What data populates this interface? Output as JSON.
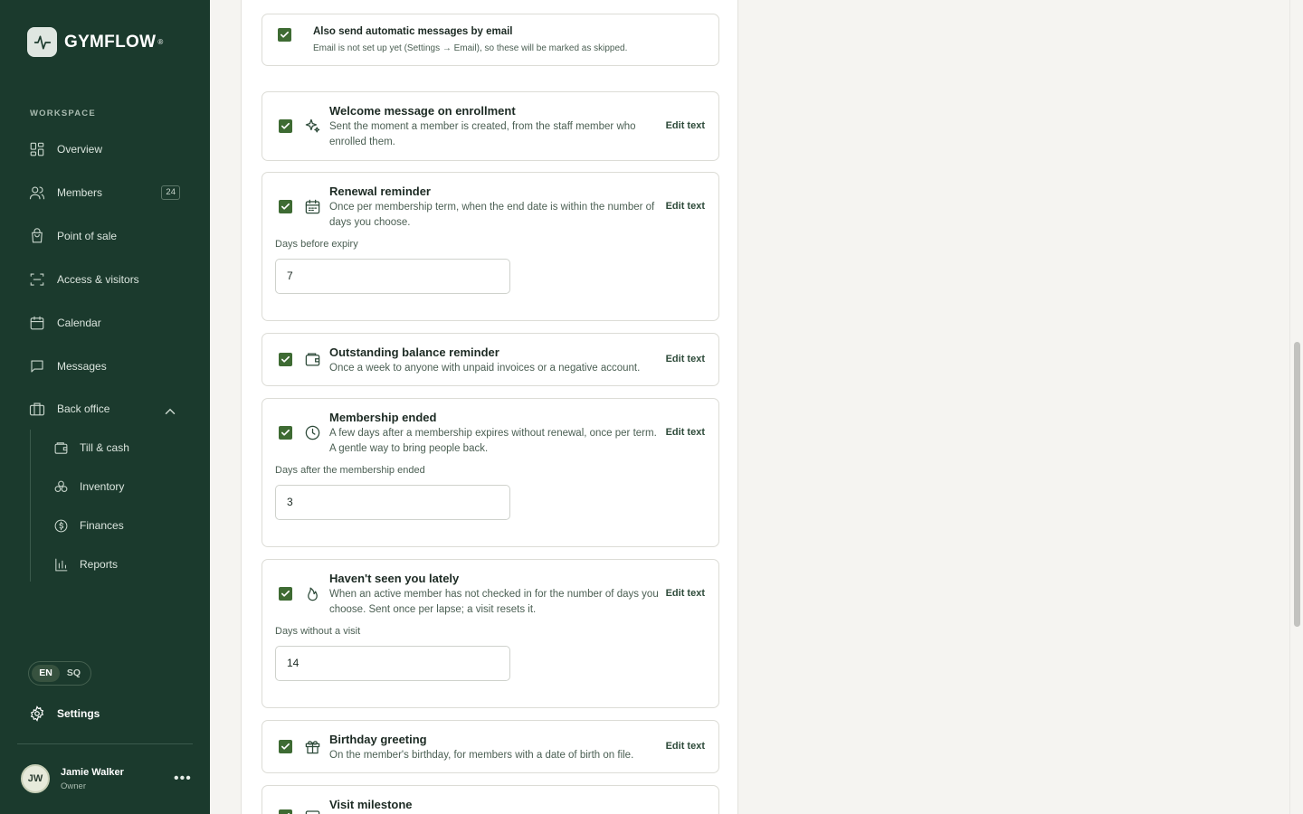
{
  "app": {
    "name": "GYMFLOW",
    "reg": "®"
  },
  "sidebar": {
    "section_label": "WORKSPACE",
    "items": [
      {
        "label": "Overview",
        "icon": "grid-icon"
      },
      {
        "label": "Members",
        "icon": "users-icon",
        "badge": "24"
      },
      {
        "label": "Point of sale",
        "icon": "shopping-bag-icon"
      },
      {
        "label": "Access & visitors",
        "icon": "scan-icon"
      },
      {
        "label": "Calendar",
        "icon": "calendar-icon"
      },
      {
        "label": "Messages",
        "icon": "message-icon"
      },
      {
        "label": "Back office",
        "icon": "building-icon"
      }
    ],
    "back_office_items": [
      {
        "label": "Till & cash",
        "icon": "wallet-icon"
      },
      {
        "label": "Inventory",
        "icon": "boxes-icon"
      },
      {
        "label": "Finances",
        "icon": "dollar-circle-icon"
      },
      {
        "label": "Reports",
        "icon": "bar-chart-icon"
      }
    ],
    "languages": [
      "EN",
      "SQ"
    ],
    "active_language": "EN",
    "settings_label": "Settings",
    "user": {
      "initials": "JW",
      "name": "Jamie Walker",
      "role": "Owner"
    }
  },
  "email_option": {
    "checked": true,
    "title": "Also send automatic messages by email",
    "description": "Email is not set up yet (Settings → Email), so these will be marked as skipped."
  },
  "edit_label": "Edit text",
  "messages": [
    {
      "title": "Welcome message on enrollment",
      "description": "Sent the moment a member is created, from the staff member who enrolled them.",
      "checked": true,
      "icon": "sparkles-icon"
    },
    {
      "title": "Renewal reminder",
      "description": "Once per membership term, when the end date is within the number of days you choose.",
      "checked": true,
      "icon": "calendar-icon",
      "field_label": "Days before expiry",
      "field_value": "7"
    },
    {
      "title": "Outstanding balance reminder",
      "description": "Once a week to anyone with unpaid invoices or a negative account.",
      "checked": true,
      "icon": "wallet-icon"
    },
    {
      "title": "Membership ended",
      "description": "A few days after a membership expires without renewal, once per term. A gentle way to bring people back.",
      "checked": true,
      "icon": "clock-icon",
      "field_label": "Days after the membership ended",
      "field_value": "3"
    },
    {
      "title": "Haven't seen you lately",
      "description": "When an active member has not checked in for the number of days you choose. Sent once per lapse; a visit resets it.",
      "checked": true,
      "icon": "flame-icon",
      "field_label": "Days without a visit",
      "field_value": "14"
    },
    {
      "title": "Birthday greeting",
      "description": "On the member's birthday, for members with a date of birth on file.",
      "checked": true,
      "icon": "gift-icon"
    },
    {
      "title": "Visit milestone",
      "description": "",
      "checked": true,
      "icon": "calendar-icon"
    }
  ],
  "colors": {
    "sidebar": "#1b3a2d",
    "accent": "#3e6b33",
    "background": "#f5f4f1"
  }
}
